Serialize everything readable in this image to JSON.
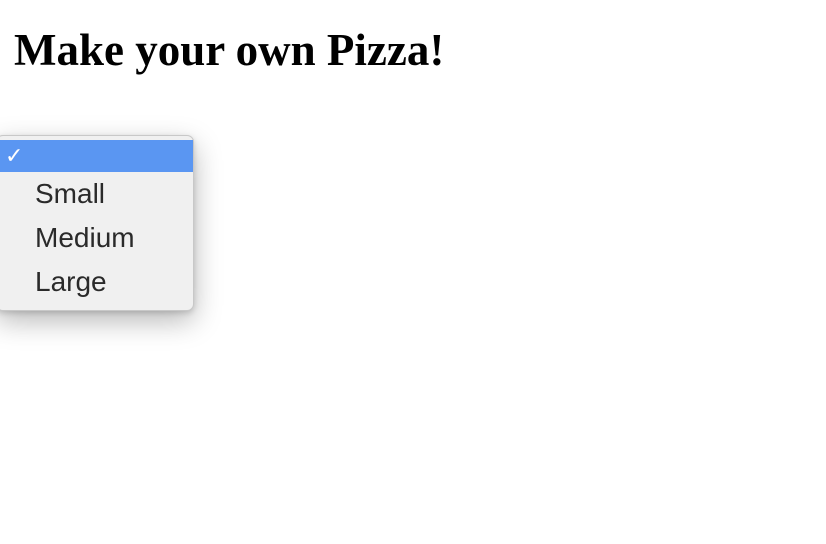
{
  "page": {
    "title": "Make your own Pizza!"
  },
  "size_dropdown": {
    "selected_index": 0,
    "options": [
      {
        "label": ""
      },
      {
        "label": "Small"
      },
      {
        "label": "Medium"
      },
      {
        "label": "Large"
      }
    ]
  }
}
